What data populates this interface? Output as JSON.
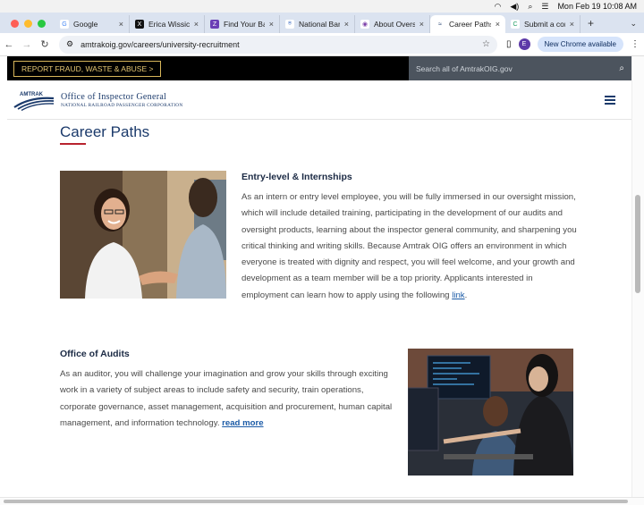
{
  "menubar": {
    "datetime": "Mon Feb 19  10:08 AM"
  },
  "tabs": [
    {
      "label": "Google",
      "fav_color": "#ffffff",
      "fav_text": "G",
      "fav_fg": "#4285f4"
    },
    {
      "label": "Erica Wissick",
      "fav_color": "#111111",
      "fav_text": "X",
      "fav_fg": "#ffffff"
    },
    {
      "label": "Find Your Ban",
      "fav_color": "#6b3fb5",
      "fav_text": "Z",
      "fav_fg": "#ffffff"
    },
    {
      "label": "National Bank",
      "fav_color": "#ffffff",
      "fav_text": "⍟",
      "fav_fg": "#3b6cc2"
    },
    {
      "label": "About Oversig",
      "fav_color": "#ffffff",
      "fav_text": "◉",
      "fav_fg": "#7b3fa8"
    },
    {
      "label": "Career Paths",
      "fav_color": "#ffffff",
      "fav_text": "≈",
      "fav_fg": "#1b3a6b"
    },
    {
      "label": "Submit a comp",
      "fav_color": "#ffffff",
      "fav_text": "C",
      "fav_fg": "#1e9c62"
    }
  ],
  "active_tab_index": 5,
  "address": {
    "url": "amtrakoig.gov/careers/university-recruitment"
  },
  "profile_initial": "E",
  "new_chrome_label": "New Chrome available",
  "site": {
    "fraud_label": "REPORT FRAUD, WASTE & ABUSE   >",
    "search_placeholder": "Search all of AmtrakOIG.gov",
    "logo_word": "AMTRAK",
    "org_line1": "Office of Inspector General",
    "org_line2": "NATIONAL RAILROAD PASSENGER CORPORATION"
  },
  "content": {
    "heading": "Career Paths",
    "section1": {
      "title": "Entry-level & Internships",
      "body": "As an intern or entry level employee, you will be fully immersed in our oversight mission, which will include detailed training, participating in the development of our audits and oversight products, learning about the inspector general community, and sharpening you critical thinking and writing skills. Because Amtrak OIG offers an environment in which everyone is treated with dignity and respect, you will feel welcome, and your growth and development as a team member will be a top priority. Applicants interested in employment can learn how to apply using the following ",
      "link": "link",
      "after": "."
    },
    "section2": {
      "title": "Office of Audits",
      "body": "As an auditor, you will challenge your imagination and grow your skills through exciting work in a variety of subject areas to include safety and security, train operations, corporate governance, asset management, acquisition and procurement, human capital management, and information technology. ",
      "link": "read more"
    }
  }
}
